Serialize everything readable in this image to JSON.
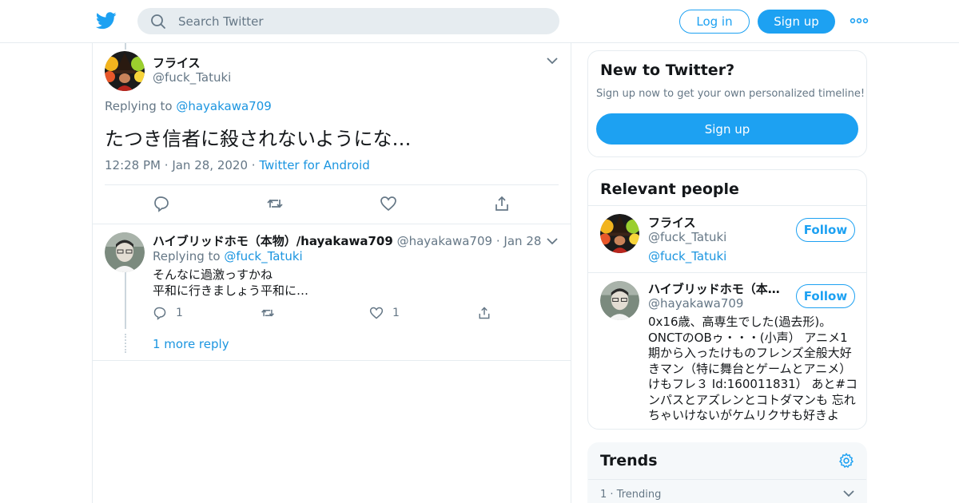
{
  "header": {
    "search_placeholder": "Search Twitter",
    "login_label": "Log in",
    "signup_label": "Sign up",
    "brand_color": "#1da1f2"
  },
  "main_tweet": {
    "name": "フライス",
    "handle": "@fuck_Tatuki",
    "replying_prefix": "Replying to ",
    "replying_to": "@hayakawa709",
    "text": "たつき信者に殺されないようにな…",
    "time": "12:28 PM",
    "date": "Jan 28, 2020",
    "source": "Twitter for Android"
  },
  "reply_tweet": {
    "name": "ハイブリッドホモ（本物）/hayakawa709",
    "handle": "@hayakawa709",
    "date": "Jan 28",
    "replying_prefix": "Replying to ",
    "replying_to": "@fuck_Tatuki",
    "text_line1": "そんなに過激っすかね",
    "text_line2": "平和に行きましょう平和に…",
    "reply_count": "1",
    "like_count": "1",
    "more_replies": "1 more reply"
  },
  "sidebar": {
    "new_card": {
      "title": "New to Twitter?",
      "subtitle": "Sign up now to get your own personalized timeline!",
      "button": "Sign up"
    },
    "relevant": {
      "title": "Relevant people",
      "people": [
        {
          "name": "フライス",
          "handle": "@fuck_Tatuki",
          "bio_link": "@fuck_Tatuki",
          "follow": "Follow"
        },
        {
          "name": "ハイブリッドホモ（本…",
          "handle": "@hayakawa709",
          "bio": "0x16歳、高専生でした(過去形)。ONCTのOBゥ・・・(小声） アニメ1期から入ったけものフレンズ全般大好きマン（特に舞台とゲームとアニメ）けもフレ３ Id:160011831） あと#コンパスとアズレンとコトダマンも 忘れちゃいけないがケムリクサも好きよ",
          "follow": "Follow"
        }
      ]
    },
    "trends": {
      "title": "Trends",
      "first_rank": "1",
      "first_label": "Trending"
    }
  }
}
